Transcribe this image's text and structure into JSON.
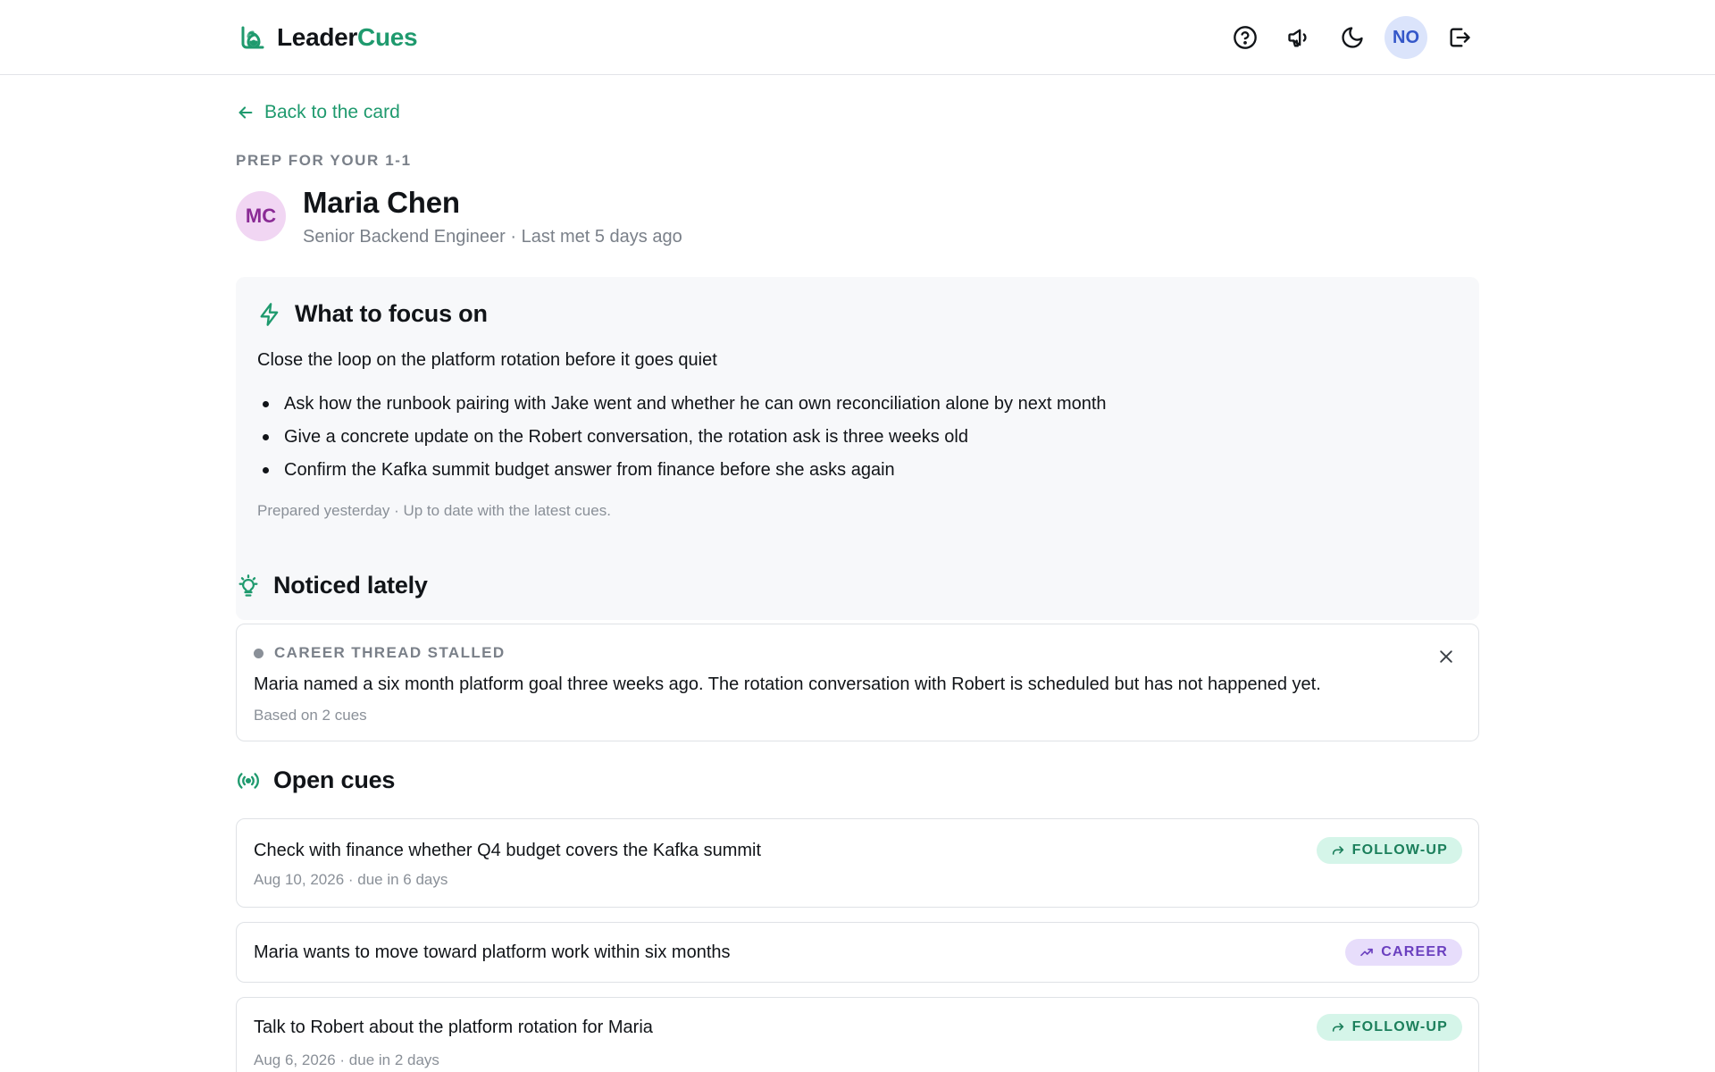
{
  "header": {
    "brand_part1": "Leader",
    "brand_part2": "Cues",
    "user_initials": "NO",
    "icons": [
      "help-icon",
      "megaphone-icon",
      "moon-icon",
      "logout-icon"
    ]
  },
  "nav": {
    "back_label": "Back to the card"
  },
  "prep": {
    "eyebrow": "PREP FOR YOUR 1-1",
    "initials": "MC",
    "name": "Maria Chen",
    "subtitle": "Senior Backend Engineer · Last met 5 days ago"
  },
  "focus": {
    "title": "What to focus on",
    "lead": "Close the loop on the platform rotation before it goes quiet",
    "items": [
      "Ask how the runbook pairing with Jake went and whether he can own reconciliation alone by next month",
      "Give a concrete update on the Robert conversation, the rotation ask is three weeks old",
      "Confirm the Kafka summit budget answer from finance before she asks again"
    ],
    "meta": "Prepared yesterday · Up to date with the latest cues."
  },
  "noticed": {
    "title": "Noticed lately",
    "items": [
      {
        "tag": "CAREER THREAD STALLED",
        "text": "Maria named a six month platform goal three weeks ago. The rotation conversation with Robert is scheduled but has not happened yet.",
        "meta": "Based on 2 cues"
      }
    ]
  },
  "cues": {
    "title": "Open cues",
    "items": [
      {
        "title": "Check with finance whether Q4 budget covers the Kafka summit",
        "meta": "Aug 10, 2026 · due in 6 days",
        "badge": "FOLLOW-UP"
      },
      {
        "title": "Maria wants to move toward platform work within six months",
        "meta": "",
        "badge": "CAREER"
      },
      {
        "title": "Talk to Robert about the platform rotation for Maria",
        "meta": "Aug 6, 2026 · due in 2 days",
        "badge": "FOLLOW-UP"
      }
    ]
  },
  "colors": {
    "accent": "#1f9a6e",
    "follow_badge_bg": "#d5f5e9",
    "career_badge_bg": "#e7ddfb"
  }
}
